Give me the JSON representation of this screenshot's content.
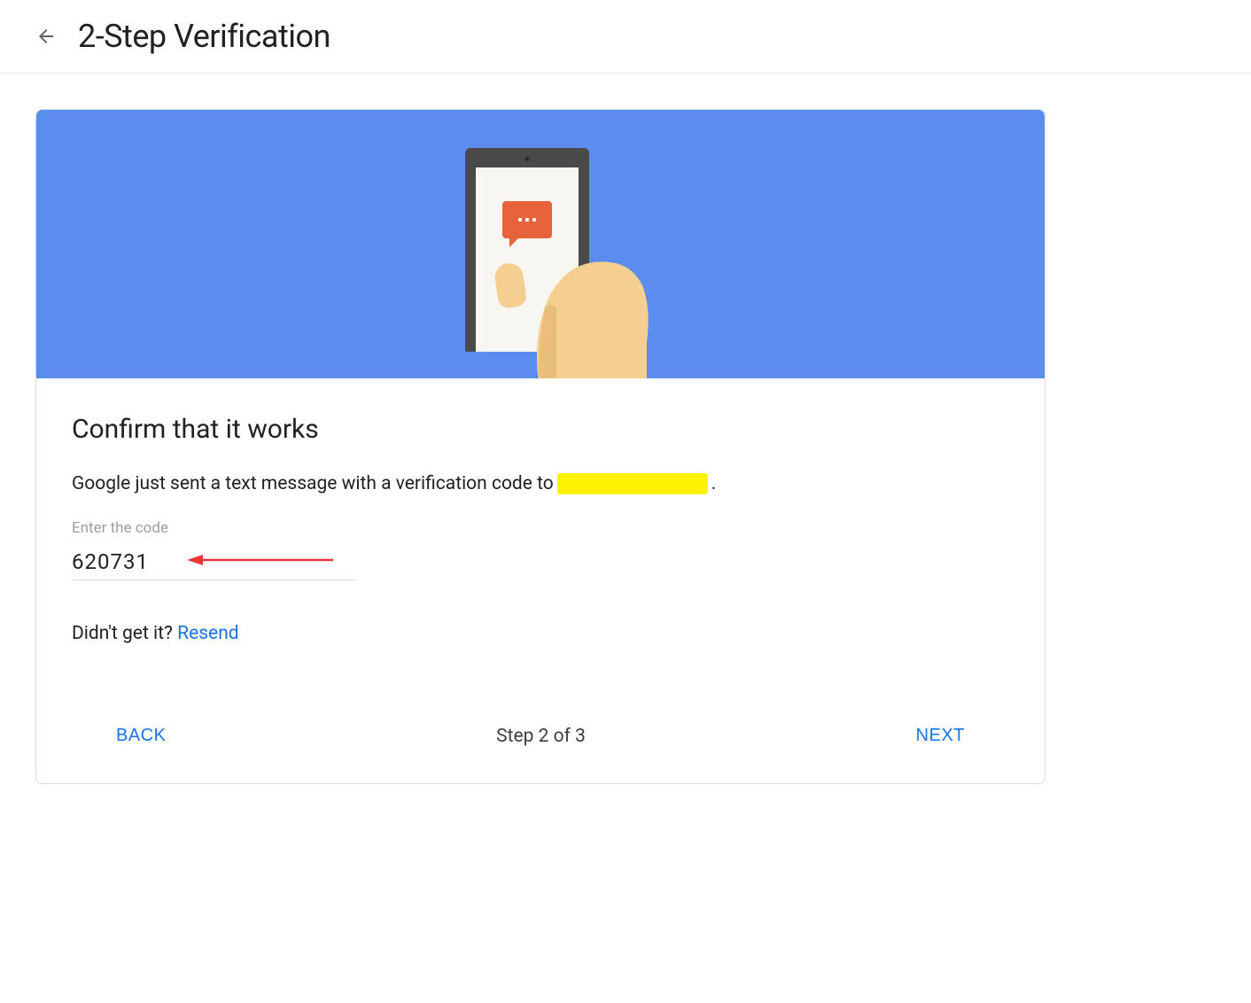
{
  "header": {
    "title": "2-Step Verification"
  },
  "card": {
    "heading": "Confirm that it works",
    "description_prefix": "Google just sent a text message with a verification code to ",
    "description_suffix": ".",
    "input_label": "Enter the code",
    "code_value": "620731",
    "resend_prompt": "Didn't get it? ",
    "resend_link": "Resend"
  },
  "footer": {
    "back_label": "BACK",
    "step_label": "Step 2 of 3",
    "next_label": "NEXT"
  }
}
